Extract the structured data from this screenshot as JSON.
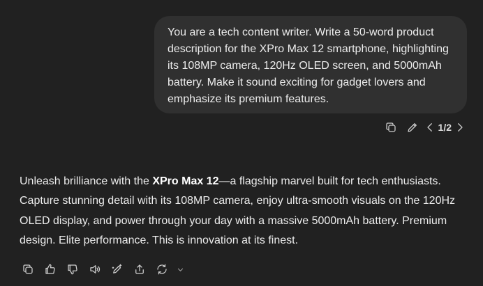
{
  "user_message": {
    "text": "You are a tech content writer. Write a 50-word product description for the XPro Max 12 smartphone, highlighting its 108MP camera, 120Hz OLED screen, and 5000mAh battery. Make it sound exciting for gadget lovers and emphasize its premium features.",
    "actions": {
      "copy_icon": "copy-icon",
      "edit_icon": "pencil-icon",
      "pager": "1/2"
    }
  },
  "assistant_message": {
    "part1": "Unleash brilliance with the ",
    "bold": "XPro Max 12",
    "part2": "—a flagship marvel built for tech enthusiasts. Capture stunning detail with its 108MP camera, enjoy ultra-smooth visuals on the 120Hz OLED display, and power through your day with a massive 5000mAh battery. Premium design. Elite performance. This is innovation at its finest.",
    "actions": [
      "copy-icon",
      "thumbs-up-icon",
      "thumbs-down-icon",
      "speaker-icon",
      "edit-canvas-icon",
      "share-icon",
      "regenerate-icon"
    ]
  },
  "colors": {
    "background": "#212121",
    "bubble": "#303030",
    "text": "#ececec",
    "icon": "#cfcfcf"
  }
}
